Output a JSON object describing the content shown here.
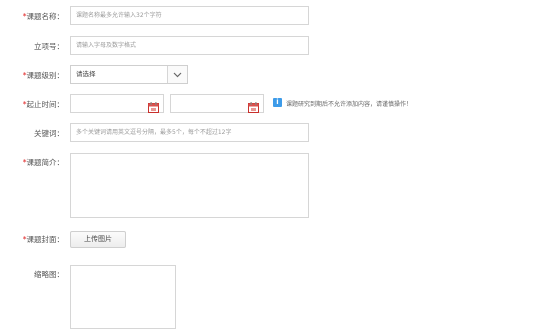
{
  "required_mark": "*",
  "form": {
    "title": {
      "label": "课题名称：",
      "placeholder": "课题名称最多允许输入32个字符"
    },
    "project_no": {
      "label": "立项号：",
      "placeholder": "请输入字母及数字格式"
    },
    "level": {
      "label": "课题级别：",
      "selected": "请选择"
    },
    "period": {
      "label": "起止时间：",
      "start_value": "",
      "end_value": "",
      "hint": "课题研究到期后不允许添加内容，请谨慎操作！"
    },
    "keywords": {
      "label": "关键词：",
      "placeholder": "多个关键词请用英文逗号分隔，最多5个，每个不超过12字"
    },
    "intro": {
      "label": "课题简介："
    },
    "cover": {
      "label": "课题封面：",
      "upload_label": "上传图片"
    },
    "thumbnail": {
      "label": "缩略图："
    }
  },
  "colors": {
    "required": "#e02020",
    "info": "#3d9be9",
    "calendar": "#d9534f"
  }
}
